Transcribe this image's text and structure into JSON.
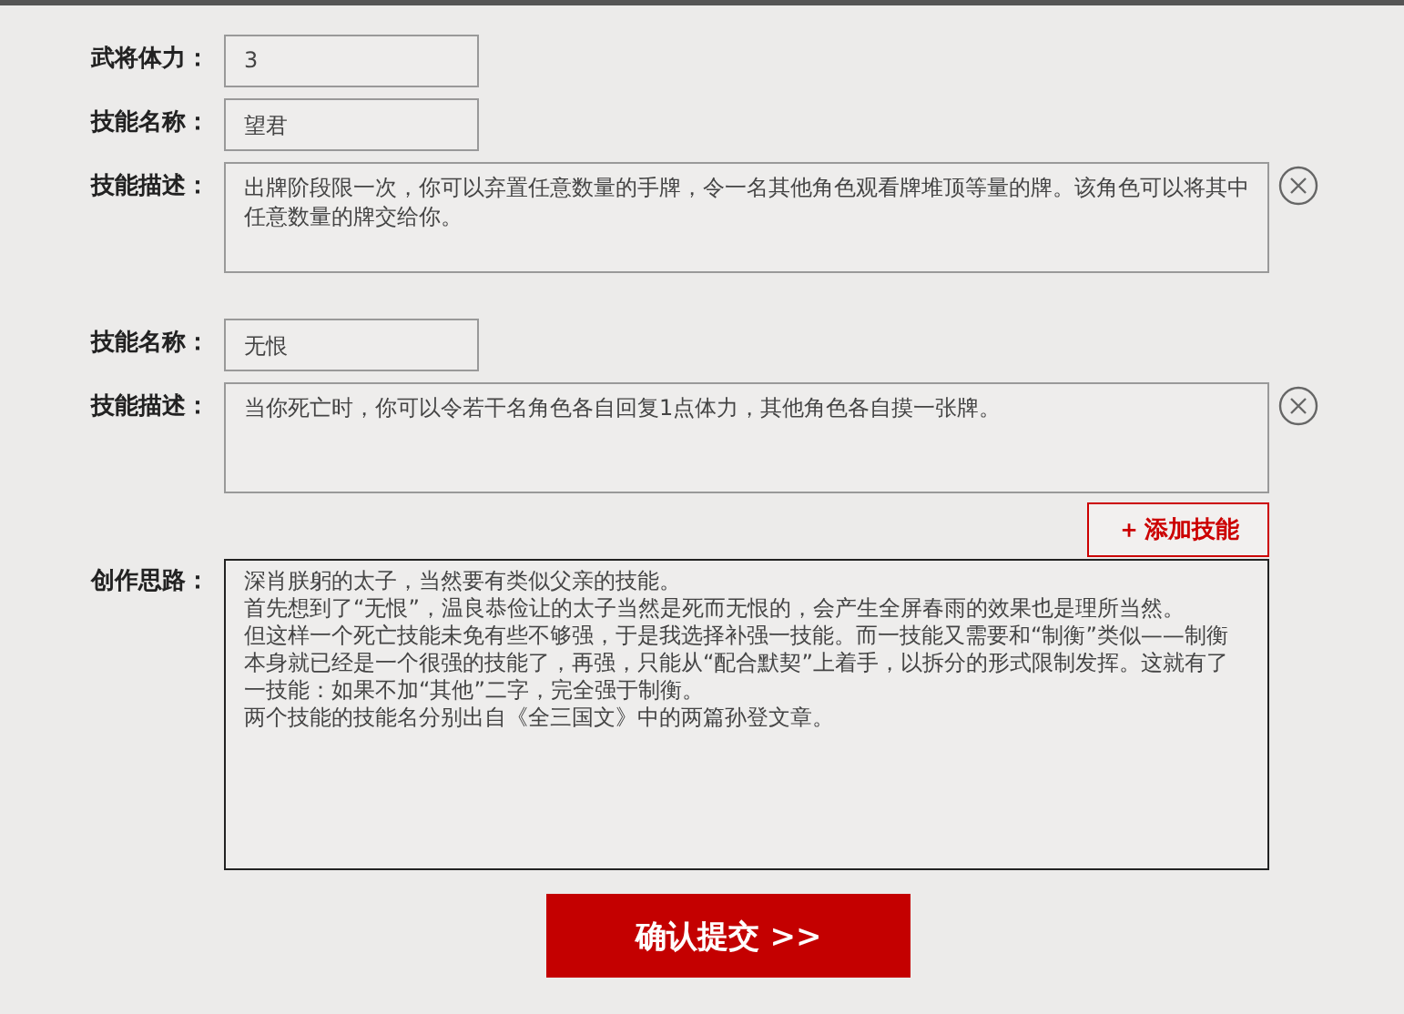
{
  "general_health": {
    "label": "武将体力：",
    "value": "3"
  },
  "skills": [
    {
      "name_label": "技能名称：",
      "name": "望君",
      "description_label": "技能描述：",
      "description": "出牌阶段限一次，你可以弃置任意数量的手牌，令一名其他角色观看牌堆顶等量的牌。该角色可以将其中任意数量的牌交给你。"
    },
    {
      "name_label": "技能名称：",
      "name": "无恨",
      "description_label": "技能描述：",
      "description": "当你死亡时，你可以令若干名角色各自回复1点体力，其他角色各自摸一张牌。"
    }
  ],
  "add_skill_button": {
    "icon": "＋",
    "label": "添加技能"
  },
  "design_idea": {
    "label": "创作思路：",
    "paragraphs": [
      "深肖朕躬的太子，当然要有类似父亲的技能。",
      "首先想到了“无恨”，温良恭俭让的太子当然是死而无恨的，会产生全屏春雨的效果也是理所当然。",
      "但这样一个死亡技能未免有些不够强，于是我选择补强一技能。而一技能又需要和“制衡”类似——制衡本身就已经是一个很强的技能了，再强，只能从“配合默契”上着手，以拆分的形式限制发挥。这就有了一技能：如果不加“其他”二字，完全强于制衡。",
      "两个技能的技能名分别出自《全三国文》中的两篇孙登文章。"
    ]
  },
  "submit_button": {
    "label": "确认提交 >>"
  }
}
